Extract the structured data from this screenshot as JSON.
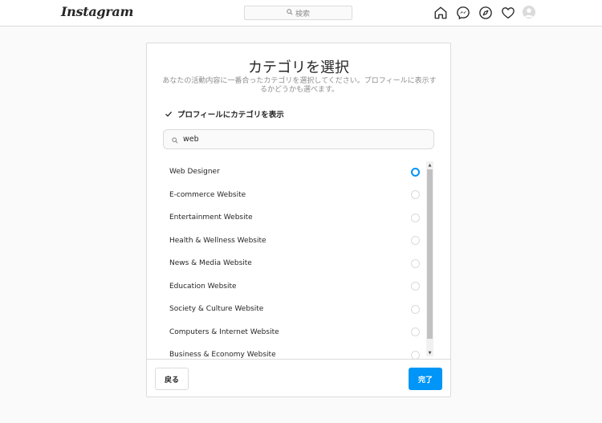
{
  "app": {
    "logo": "Instagram"
  },
  "topbar": {
    "search_placeholder": "検索",
    "icons": [
      "home-icon",
      "messenger-icon",
      "explore-icon",
      "heart-icon",
      "avatar"
    ]
  },
  "dialog": {
    "title": "カテゴリを選択",
    "subtitle": "あなたの活動内容に一番合ったカテゴリを選択してください。プロフィールに表示するかどうかも選べます。",
    "show_on_profile": {
      "label": "プロフィールにカテゴリを表示",
      "checked": true
    },
    "search": {
      "value": "web"
    },
    "categories": [
      {
        "label": "Web Designer",
        "selected": true
      },
      {
        "label": "E-commerce Website",
        "selected": false
      },
      {
        "label": "Entertainment Website",
        "selected": false
      },
      {
        "label": "Health & Wellness Website",
        "selected": false
      },
      {
        "label": "News & Media Website",
        "selected": false
      },
      {
        "label": "Education Website",
        "selected": false
      },
      {
        "label": "Society & Culture Website",
        "selected": false
      },
      {
        "label": "Computers & Internet Website",
        "selected": false
      },
      {
        "label": "Business & Economy Website",
        "selected": false
      }
    ],
    "back_label": "戻る",
    "done_label": "完了"
  },
  "colors": {
    "accent": "#0095f6",
    "border": "#dbdbdb",
    "background": "#fafafa"
  }
}
